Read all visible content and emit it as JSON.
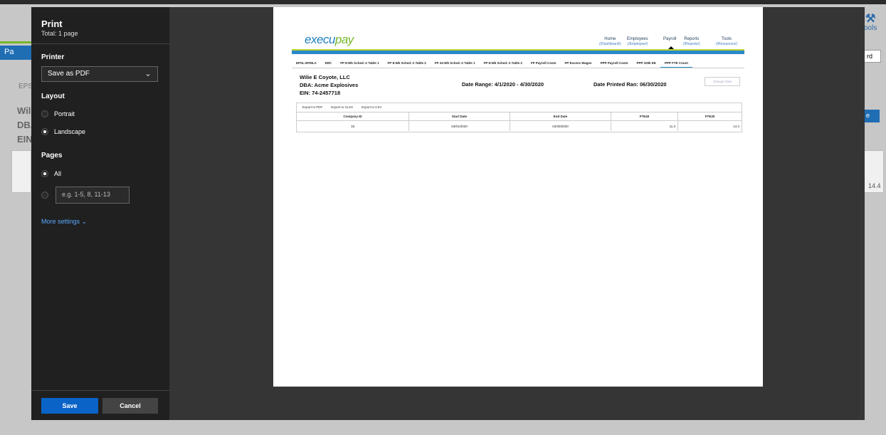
{
  "background": {
    "right_label": "ools",
    "left_tab": "Pa",
    "eps": "EPS",
    "company_lines": [
      "Wili",
      "DBA",
      "EIN"
    ],
    "right_tab": "rd",
    "right_button": "e",
    "right_value": "14.4"
  },
  "print": {
    "title": "Print",
    "total": "Total: 1 page",
    "printer_label": "Printer",
    "printer_value": "Save as PDF",
    "layout_label": "Layout",
    "portrait": "Portrait",
    "landscape": "Landscape",
    "pages_label": "Pages",
    "all": "All",
    "range_placeholder": "e.g. 1-5, 8, 11-13",
    "more_settings": "More settings",
    "save": "Save",
    "cancel": "Cancel"
  },
  "preview": {
    "logo_a": "execu",
    "logo_b": "pay",
    "nav": [
      {
        "label": "Home",
        "sub": "(/Dashboard/)"
      },
      {
        "label": "Employees",
        "sub": "(/Employee/)"
      },
      {
        "label": "Payroll",
        "sub": ""
      },
      {
        "label": "Reports",
        "sub": "(/Reports/)"
      },
      {
        "label": "Tools",
        "sub": "(/Resources/)"
      }
    ],
    "tabs": [
      "EPSL-EFMLA",
      "ERC",
      "FP 8-Wk Sched. A Table 1",
      "FP 8-Wk Sched. A Table 2",
      "FP 24-Wk Sched. A Table 1",
      "FP 8-Wk Sched. A Table 2",
      "FP Payroll Costs",
      "FP Excess Wages",
      "PPP Payroll Costs",
      "PPP 100k EE",
      "PPP FTE Count"
    ],
    "company": "Wilie E Coyote, LLC",
    "dba": "DBA: Acme Explosives",
    "ein": "EIN: 74-2457718",
    "date_range": "Date Range: 4/1/2020 - 4/30/2020",
    "date_printed": "Date Printed Ran: 06/30/2020",
    "change_date": "Change Date",
    "exports": [
      "Export to PDF",
      "Export to XLSX",
      "Export to CSV"
    ],
    "columns": [
      "Company ID",
      "Start Date",
      "End Date",
      "FTE40",
      "FTE30"
    ],
    "row": [
      "18",
      "04/01/2020",
      "04/30/2020",
      "11.3",
      "14.4"
    ]
  }
}
